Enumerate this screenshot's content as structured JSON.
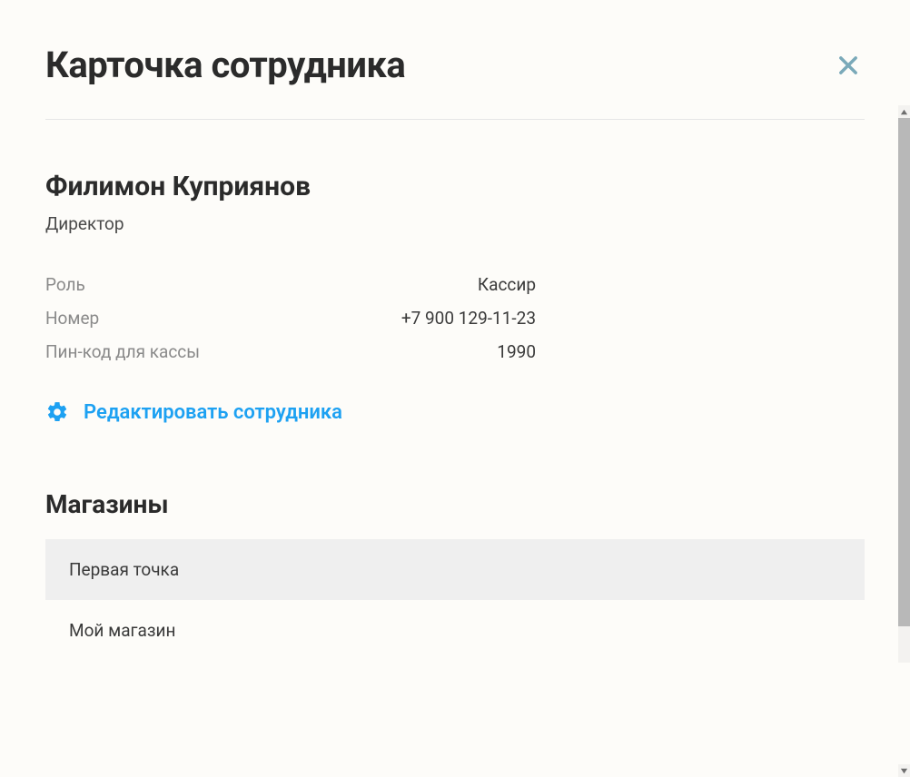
{
  "header": {
    "title": "Карточка сотрудника"
  },
  "employee": {
    "name": "Филимон Куприянов",
    "position": "Директор",
    "fields": {
      "role_label": "Роль",
      "role_value": "Кассир",
      "phone_label": "Номер",
      "phone_value": "+7 900 129-11-23",
      "pin_label": "Пин-код для кассы",
      "pin_value": "1990"
    },
    "edit_label": "Редактировать сотрудника"
  },
  "stores": {
    "title": "Магазины",
    "items": [
      {
        "name": "Первая точка"
      },
      {
        "name": "Мой магазин"
      }
    ]
  }
}
